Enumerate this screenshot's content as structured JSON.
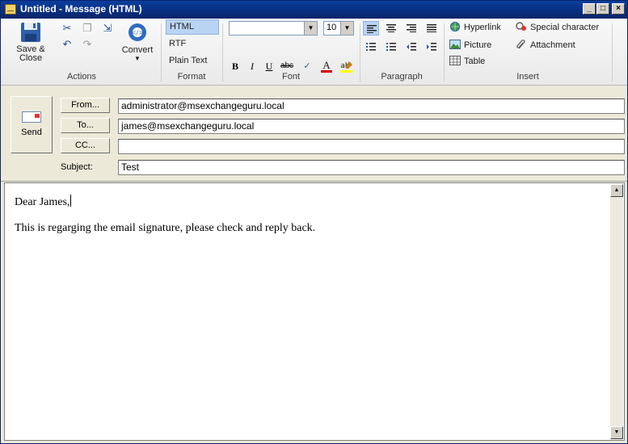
{
  "window": {
    "title": "Untitled - Message (HTML)"
  },
  "ribbon": {
    "actions": {
      "save_close": "Save &",
      "save_close_2": "Close",
      "convert": "Convert",
      "group_label": "Actions"
    },
    "format": {
      "items": [
        "HTML",
        "RTF",
        "Plain Text"
      ],
      "selected": "HTML",
      "group_label": "Format"
    },
    "font": {
      "font_name": "",
      "font_size": "10",
      "group_label": "Font",
      "buttons": [
        "B",
        "I",
        "U",
        "abc"
      ]
    },
    "paragraph": {
      "group_label": "Paragraph"
    },
    "insert": {
      "hyperlink": "Hyperlink",
      "picture": "Picture",
      "table": "Table",
      "special_character": "Special character",
      "attachment": "Attachment",
      "group_label": "Insert"
    }
  },
  "header": {
    "send": "Send",
    "from_button": "From...",
    "to_button": "To...",
    "cc_button": "CC...",
    "subject_label": "Subject:",
    "from_value": "administrator@msexchangeguru.local",
    "to_value": "james@msexchangeguru.local",
    "cc_value": "",
    "subject_value": "Test"
  },
  "body": {
    "greeting": "Dear James,",
    "line": "This is regarging the email signature, please check and reply back."
  },
  "colors": {
    "title_bar": "#0a246a",
    "chrome": "#ece9d8",
    "selected": "#b9d4f3",
    "font_color_underline": "#d00000",
    "highlight_yellow": "#ffff00"
  }
}
